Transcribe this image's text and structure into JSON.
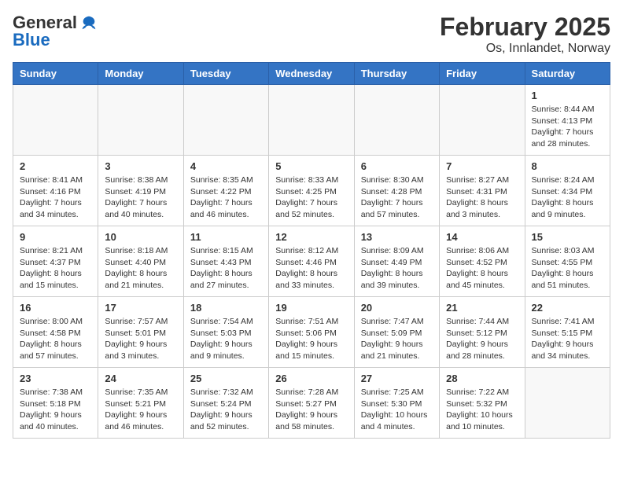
{
  "header": {
    "logo_general": "General",
    "logo_blue": "Blue",
    "title": "February 2025",
    "subtitle": "Os, Innlandet, Norway"
  },
  "weekdays": [
    "Sunday",
    "Monday",
    "Tuesday",
    "Wednesday",
    "Thursday",
    "Friday",
    "Saturday"
  ],
  "weeks": [
    [
      {
        "day": "",
        "info": ""
      },
      {
        "day": "",
        "info": ""
      },
      {
        "day": "",
        "info": ""
      },
      {
        "day": "",
        "info": ""
      },
      {
        "day": "",
        "info": ""
      },
      {
        "day": "",
        "info": ""
      },
      {
        "day": "1",
        "info": "Sunrise: 8:44 AM\nSunset: 4:13 PM\nDaylight: 7 hours and 28 minutes."
      }
    ],
    [
      {
        "day": "2",
        "info": "Sunrise: 8:41 AM\nSunset: 4:16 PM\nDaylight: 7 hours and 34 minutes."
      },
      {
        "day": "3",
        "info": "Sunrise: 8:38 AM\nSunset: 4:19 PM\nDaylight: 7 hours and 40 minutes."
      },
      {
        "day": "4",
        "info": "Sunrise: 8:35 AM\nSunset: 4:22 PM\nDaylight: 7 hours and 46 minutes."
      },
      {
        "day": "5",
        "info": "Sunrise: 8:33 AM\nSunset: 4:25 PM\nDaylight: 7 hours and 52 minutes."
      },
      {
        "day": "6",
        "info": "Sunrise: 8:30 AM\nSunset: 4:28 PM\nDaylight: 7 hours and 57 minutes."
      },
      {
        "day": "7",
        "info": "Sunrise: 8:27 AM\nSunset: 4:31 PM\nDaylight: 8 hours and 3 minutes."
      },
      {
        "day": "8",
        "info": "Sunrise: 8:24 AM\nSunset: 4:34 PM\nDaylight: 8 hours and 9 minutes."
      }
    ],
    [
      {
        "day": "9",
        "info": "Sunrise: 8:21 AM\nSunset: 4:37 PM\nDaylight: 8 hours and 15 minutes."
      },
      {
        "day": "10",
        "info": "Sunrise: 8:18 AM\nSunset: 4:40 PM\nDaylight: 8 hours and 21 minutes."
      },
      {
        "day": "11",
        "info": "Sunrise: 8:15 AM\nSunset: 4:43 PM\nDaylight: 8 hours and 27 minutes."
      },
      {
        "day": "12",
        "info": "Sunrise: 8:12 AM\nSunset: 4:46 PM\nDaylight: 8 hours and 33 minutes."
      },
      {
        "day": "13",
        "info": "Sunrise: 8:09 AM\nSunset: 4:49 PM\nDaylight: 8 hours and 39 minutes."
      },
      {
        "day": "14",
        "info": "Sunrise: 8:06 AM\nSunset: 4:52 PM\nDaylight: 8 hours and 45 minutes."
      },
      {
        "day": "15",
        "info": "Sunrise: 8:03 AM\nSunset: 4:55 PM\nDaylight: 8 hours and 51 minutes."
      }
    ],
    [
      {
        "day": "16",
        "info": "Sunrise: 8:00 AM\nSunset: 4:58 PM\nDaylight: 8 hours and 57 minutes."
      },
      {
        "day": "17",
        "info": "Sunrise: 7:57 AM\nSunset: 5:01 PM\nDaylight: 9 hours and 3 minutes."
      },
      {
        "day": "18",
        "info": "Sunrise: 7:54 AM\nSunset: 5:03 PM\nDaylight: 9 hours and 9 minutes."
      },
      {
        "day": "19",
        "info": "Sunrise: 7:51 AM\nSunset: 5:06 PM\nDaylight: 9 hours and 15 minutes."
      },
      {
        "day": "20",
        "info": "Sunrise: 7:47 AM\nSunset: 5:09 PM\nDaylight: 9 hours and 21 minutes."
      },
      {
        "day": "21",
        "info": "Sunrise: 7:44 AM\nSunset: 5:12 PM\nDaylight: 9 hours and 28 minutes."
      },
      {
        "day": "22",
        "info": "Sunrise: 7:41 AM\nSunset: 5:15 PM\nDaylight: 9 hours and 34 minutes."
      }
    ],
    [
      {
        "day": "23",
        "info": "Sunrise: 7:38 AM\nSunset: 5:18 PM\nDaylight: 9 hours and 40 minutes."
      },
      {
        "day": "24",
        "info": "Sunrise: 7:35 AM\nSunset: 5:21 PM\nDaylight: 9 hours and 46 minutes."
      },
      {
        "day": "25",
        "info": "Sunrise: 7:32 AM\nSunset: 5:24 PM\nDaylight: 9 hours and 52 minutes."
      },
      {
        "day": "26",
        "info": "Sunrise: 7:28 AM\nSunset: 5:27 PM\nDaylight: 9 hours and 58 minutes."
      },
      {
        "day": "27",
        "info": "Sunrise: 7:25 AM\nSunset: 5:30 PM\nDaylight: 10 hours and 4 minutes."
      },
      {
        "day": "28",
        "info": "Sunrise: 7:22 AM\nSunset: 5:32 PM\nDaylight: 10 hours and 10 minutes."
      },
      {
        "day": "",
        "info": ""
      }
    ]
  ]
}
